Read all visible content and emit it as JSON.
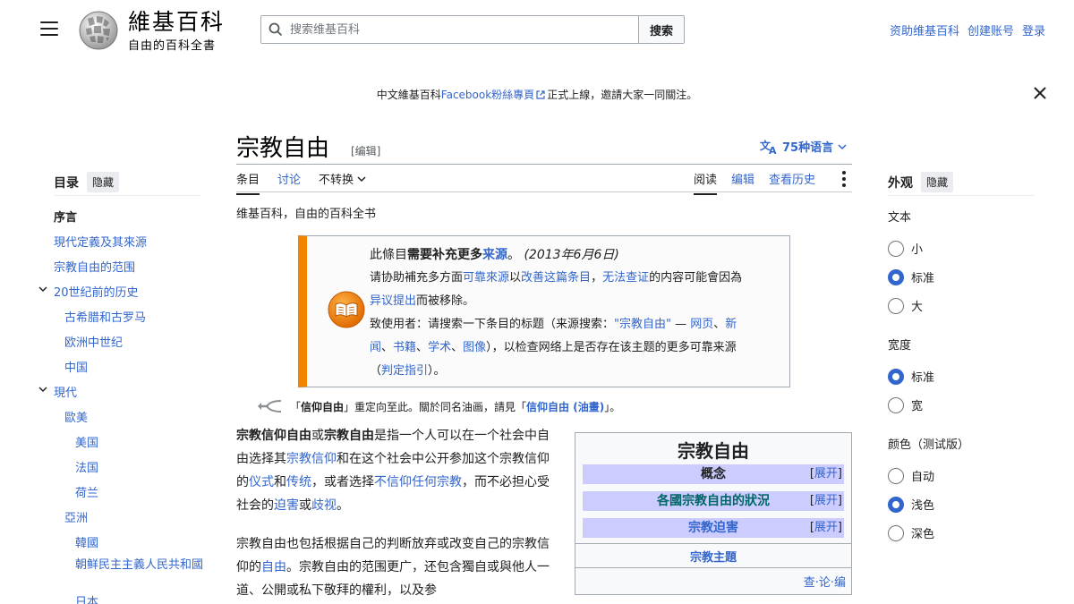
{
  "header": {
    "wordmark_title": "維基百科",
    "wordmark_subtitle": "自由的百科全書",
    "search_placeholder": "搜索维基百科",
    "search_button": "搜索",
    "user_links": [
      "资助维基百科",
      "创建账号",
      "登录"
    ]
  },
  "banner": {
    "prefix": "中文維基百科",
    "link": "Facebook粉絲專頁",
    "suffix": "正式上線，邀請大家一同關注。"
  },
  "article": {
    "title": "宗教自由",
    "edit_label": "[编辑]",
    "languages": "75种语言",
    "tabs_left": [
      "条目",
      "讨论",
      "不转换"
    ],
    "tabs_right": [
      "阅读",
      "编辑",
      "查看历史"
    ],
    "tagline": "维基百科，自由的百科全书"
  },
  "toc": {
    "heading": "目录",
    "hide": "隐藏",
    "items": [
      "序言",
      "現代定義及其來源",
      "宗教自由的范围",
      "20世纪前的历史",
      "古希腊和古罗马",
      "欧洲中世纪",
      "中国",
      "現代",
      "歐美",
      "美国",
      "法国",
      "荷兰",
      "亞洲",
      "韓國",
      "朝鲜民主主義人民共和國",
      "日本"
    ]
  },
  "ambox": {
    "l1_a": "此條目",
    "l1_b": "需要补充更多",
    "l1_link": "来源",
    "l1_end": "。",
    "l1_date": "(2013年6月6日)",
    "l2_a": "请协助補充多方面",
    "l2_link1": "可靠來源",
    "l2_b": "以",
    "l2_link2": "改善这篇条目",
    "l2_c": "，",
    "l2_link3": "无法查证",
    "l2_d": "的内容可能會因為",
    "l3_link": "异议提出",
    "l3_a": "而被移除。",
    "l4_a": "致使用者：请搜索一下条目的标题（来源搜索：",
    "l4_link1": "\"宗教自由\"",
    "l4_b": " — ",
    "l4_link2": "网页",
    "l4_c": "、",
    "l4_link3": "新",
    "l5_link1": "闻",
    "l5_a": "、",
    "l5_link2": "书籍",
    "l5_b": "、",
    "l5_link3": "学术",
    "l5_c": "、",
    "l5_link4": "图像",
    "l5_d": "），以检查网络上是否存在该主题的更多可靠来源",
    "l6_a": "（",
    "l6_link": "判定指引",
    "l6_b": "）。"
  },
  "hatnote": {
    "a": "「",
    "b": "信仰自由",
    "c": "」重定向至此。關於同名油画，請見「",
    "link": "信仰自由 (油畫)",
    "d": "」。"
  },
  "body": {
    "p1_1": "宗教信仰自由",
    "p1_2": "或",
    "p1_3": "宗教自由",
    "p1_4": "是指一个人可以在一个社会中自由选择其",
    "p1_l1": "宗教信仰",
    "p1_5": "和在这个社会中公开参加这个宗教信仰的",
    "p1_l2": "仪式",
    "p1_6": "和",
    "p1_l3": "传统",
    "p1_7": "，或者选择",
    "p1_l4": "不信仰任何宗教",
    "p1_8": "，而不必担心受社会的",
    "p1_l5": "迫害",
    "p1_9": "或",
    "p1_l6": "歧视",
    "p1_10": "。",
    "p2_1": "宗教自由也包括根据自己的判断放弃或改变自己的宗教信仰的",
    "p2_l1": "自由",
    "p2_2": "。宗教自由的范围更广，还包含獨自或與他人一道、公開或私下敬拜的權利，以及参"
  },
  "infobox": {
    "title": "宗教自由",
    "rows": [
      "概念",
      "各國宗教自由的狀況",
      "宗教迫害"
    ],
    "expand_l": "[",
    "expand": "展开",
    "expand_r": "]",
    "topic": "宗教主題",
    "vte": "查·论·编"
  },
  "appearance": {
    "heading": "外观",
    "hide": "隐藏",
    "text_label": "文本",
    "text_options": [
      "小",
      "标准",
      "大"
    ],
    "width_label": "宽度",
    "width_options": [
      "标准",
      "宽"
    ],
    "color_label": "颜色（测试版）",
    "color_options": [
      "自动",
      "浅色",
      "深色"
    ]
  }
}
